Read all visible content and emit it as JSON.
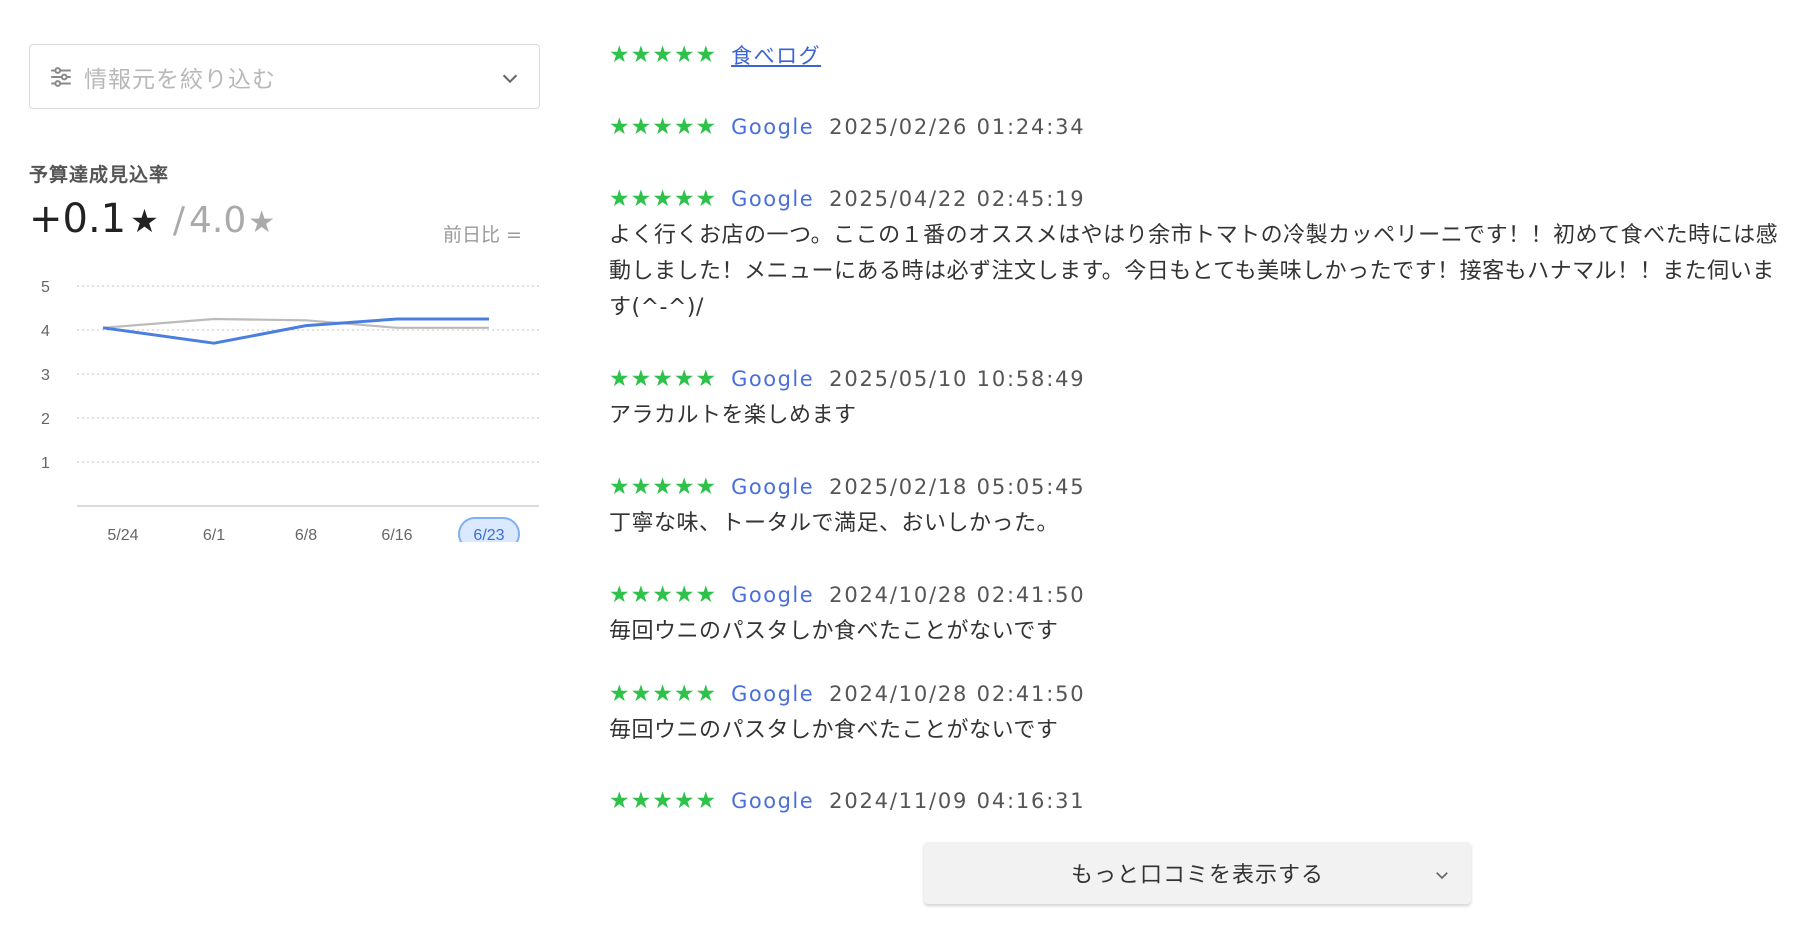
{
  "filter": {
    "placeholder": "情報元を絞り込む",
    "icon": "sliders-icon"
  },
  "metric": {
    "title": "予算達成見込率",
    "value": "+0.1",
    "star": "★",
    "slash": "/",
    "total": "4.0",
    "compare_label": "前日比 ="
  },
  "chart_data": {
    "type": "line",
    "x": [
      "5/24",
      "6/1",
      "6/8",
      "6/16",
      "6/23"
    ],
    "selected_x": "6/23",
    "yticks": [
      "5",
      "4",
      "3",
      "2",
      "1"
    ],
    "ylim": [
      0,
      5
    ],
    "grid": true,
    "series": [
      {
        "values": [
          4.05,
          4.25,
          4.22,
          4.05,
          4.05
        ],
        "color": "#bbbbbb"
      },
      {
        "values": [
          4.05,
          3.7,
          4.1,
          4.25,
          4.25
        ],
        "color": "#4a7fe0"
      }
    ]
  },
  "colors": {
    "star": "#2ec24a",
    "source": "#4a6fdc",
    "line_primary": "#4a7fe0",
    "line_secondary": "#bbbbbb"
  },
  "reviews": [
    {
      "stars": "★★★★★",
      "source": "食べログ",
      "date": "",
      "text": ""
    },
    {
      "stars": "★★★★★",
      "source": "Google",
      "date": "2025/02/26 01:24:34",
      "text": ""
    },
    {
      "stars": "★★★★★",
      "source": "Google",
      "date": "2025/04/22 02:45:19",
      "text": "よく行くお店の一つ。ここの１番のオススメはやはり余市トマトの冷製カッペリーニです！！初めて食べた時には感動しました！メニューにある時は必ず注文します。今日もとても美味しかったです！接客もハナマル！！また伺います(^-^)/"
    },
    {
      "stars": "★★★★★",
      "source": "Google",
      "date": "2025/05/10 10:58:49",
      "text": "アラカルトを楽しめます"
    },
    {
      "stars": "★★★★★",
      "source": "Google",
      "date": "2025/02/18 05:05:45",
      "text": "丁寧な味、トータルで満足、おいしかった。"
    },
    {
      "stars": "★★★★★",
      "source": "Google",
      "date": "2024/10/28 02:41:50",
      "text": "毎回ウニのパスタしか食べたことがないです"
    },
    {
      "stars": "★★★★★",
      "source": "Google",
      "date": "2024/10/28 02:41:50",
      "text": "毎回ウニのパスタしか食べたことがないです"
    },
    {
      "stars": "★★★★★",
      "source": "Google",
      "date": "2024/11/09 04:16:31",
      "text": ""
    }
  ],
  "more_button": {
    "label": "もっと口コミを表示する"
  }
}
